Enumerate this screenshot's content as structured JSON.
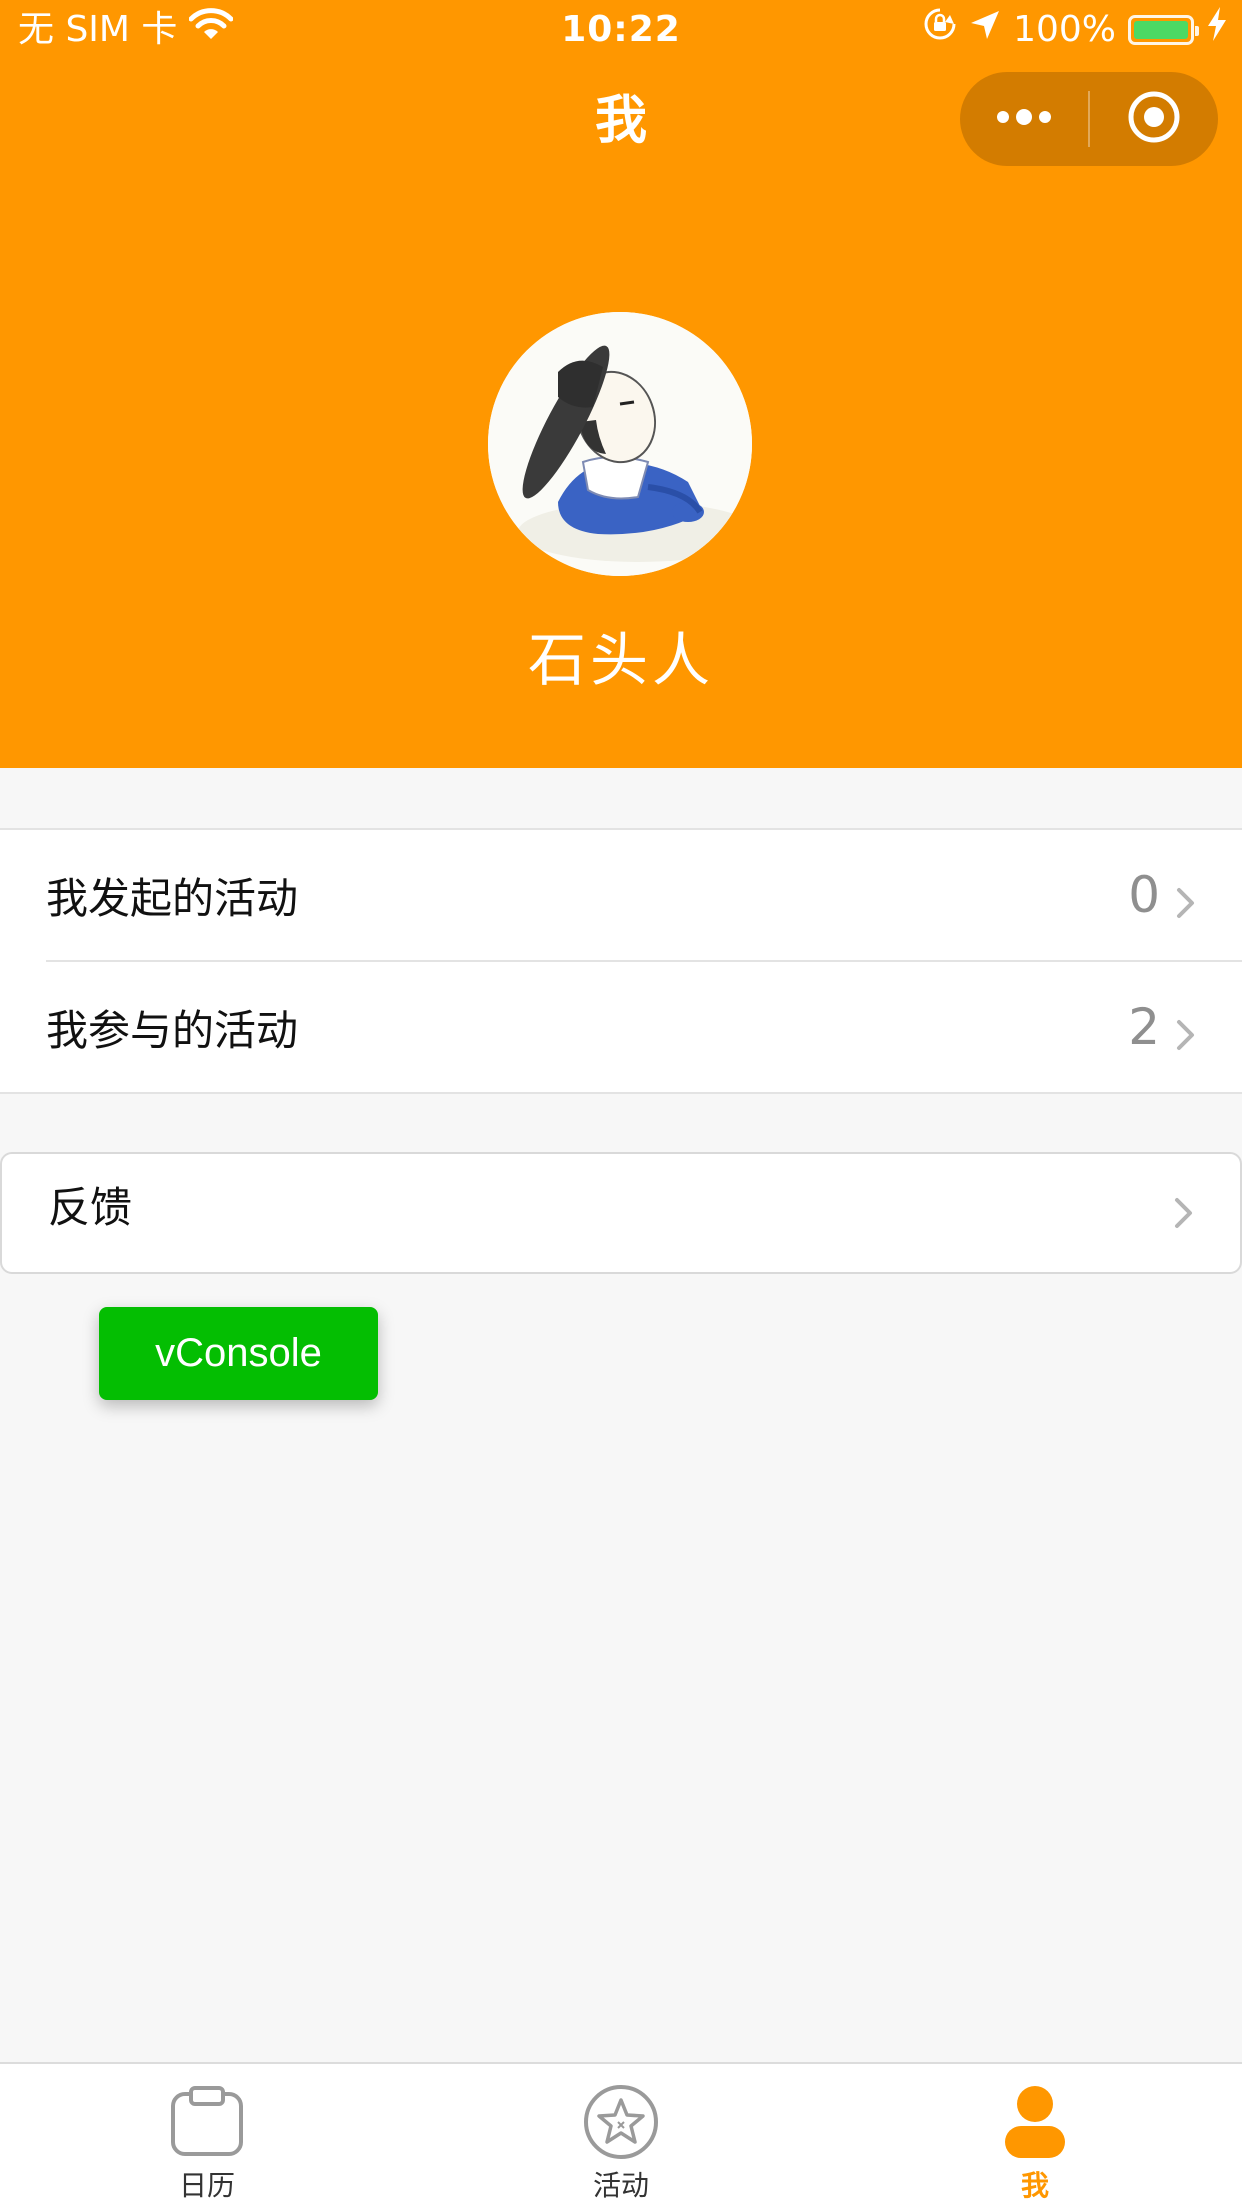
{
  "status_bar": {
    "carrier": "无 SIM 卡",
    "time": "10:22",
    "battery": "100%",
    "battery_level": 1.0,
    "battery_color": "#4cd964"
  },
  "nav": {
    "title": "我",
    "capsule_icons": [
      "more-dots-icon",
      "close-circle-icon"
    ]
  },
  "theme": {
    "accent": "#ff9700",
    "capsule_bg": "#d37c00",
    "vconsole_green": "#04be02"
  },
  "profile": {
    "avatar_icon": "avatar-illustration",
    "name": "石头人"
  },
  "activity_list": [
    {
      "label": "我发起的活动",
      "count": "0"
    },
    {
      "label": "我参与的活动",
      "count": "2"
    }
  ],
  "feedback": {
    "label": "反馈"
  },
  "vconsole": {
    "label": "vConsole"
  },
  "tabbar": {
    "tabs": [
      {
        "label": "日历",
        "icon": "calendar-icon",
        "active": false
      },
      {
        "label": "活动",
        "icon": "star-badge-icon",
        "active": false
      },
      {
        "label": "我",
        "icon": "person-icon",
        "active": true
      }
    ]
  }
}
